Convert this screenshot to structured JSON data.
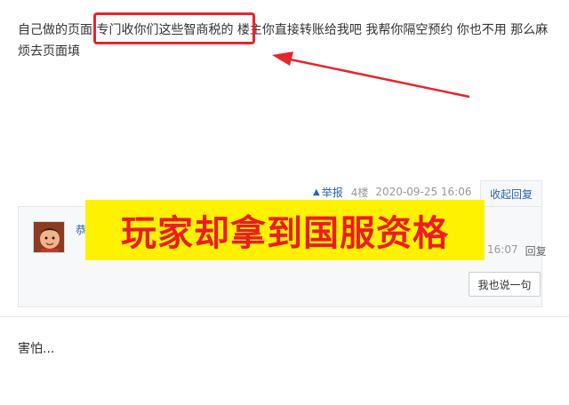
{
  "post": {
    "text": "自己做的页面 专门收你们这些智商税的 楼主你直接转账给我吧 我帮你隔空预约 你也不用 那么麻烦去页面填",
    "report_label": "举报",
    "floor": "4楼",
    "date": "2020-09-25 16:06",
    "collapse_label": "收起回复"
  },
  "reply": {
    "user": "恭",
    "time": "16:07",
    "reply_label": "回复",
    "say_button": "我也说一句"
  },
  "overlay": {
    "banner_text": "玩家却拿到国服资格",
    "banner_bg": "#fff200",
    "banner_color": "#ec1c24",
    "highlight_color": "#e8252b"
  },
  "next_post": {
    "text": "害怕..."
  },
  "colors": {
    "link": "#2d64b3",
    "meta": "#999999",
    "panel_bg": "#f7f8fa"
  }
}
